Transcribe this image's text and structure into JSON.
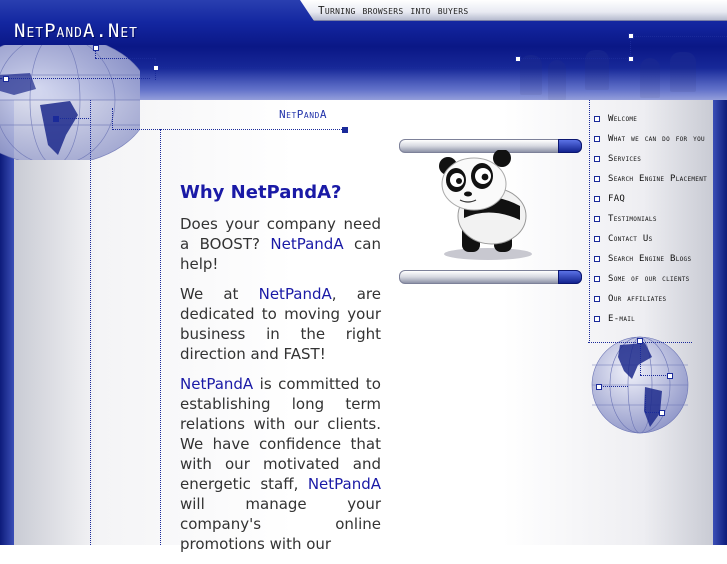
{
  "header": {
    "brand": "NetPandA.Net",
    "tagline": "Turning browsers into buyers"
  },
  "section_title": "NetPandA",
  "main": {
    "heading": "Why NetPandA?",
    "p1_before": "Does your company need a BOOST? ",
    "p1_brand": "NetPandA",
    "p1_after": " can help!",
    "p2_before": "We at ",
    "p2_brand": "NetPandA",
    "p2_after": ", are dedicated to moving your business in the right direction and FAST!",
    "p3_brand1": "NetPandA",
    "p3_middle": " is committed to establishing long term relations with our clients. We have confidence that with our motivated and energetic staff, ",
    "p3_brand2": "NetPandA",
    "p3_after": " will manage your company's online promotions with our"
  },
  "nav": {
    "items": [
      {
        "label": "Welcome"
      },
      {
        "label": "What we can do for you"
      },
      {
        "label": "Services"
      },
      {
        "label": "Search Engine Placement"
      },
      {
        "label": "FAQ"
      },
      {
        "label": "Testimonials"
      },
      {
        "label": "Contact Us"
      },
      {
        "label": "Search Engine Blogs"
      },
      {
        "label": "Some of our clients"
      },
      {
        "label": "Our affiliates"
      },
      {
        "label": "E-mail"
      }
    ]
  },
  "icons": {
    "panda": "panda-mascot-icon",
    "globe": "globe-icon"
  },
  "colors": {
    "header_blue": "#0a1786",
    "link_blue": "#1a1aa6",
    "text": "#333333"
  }
}
